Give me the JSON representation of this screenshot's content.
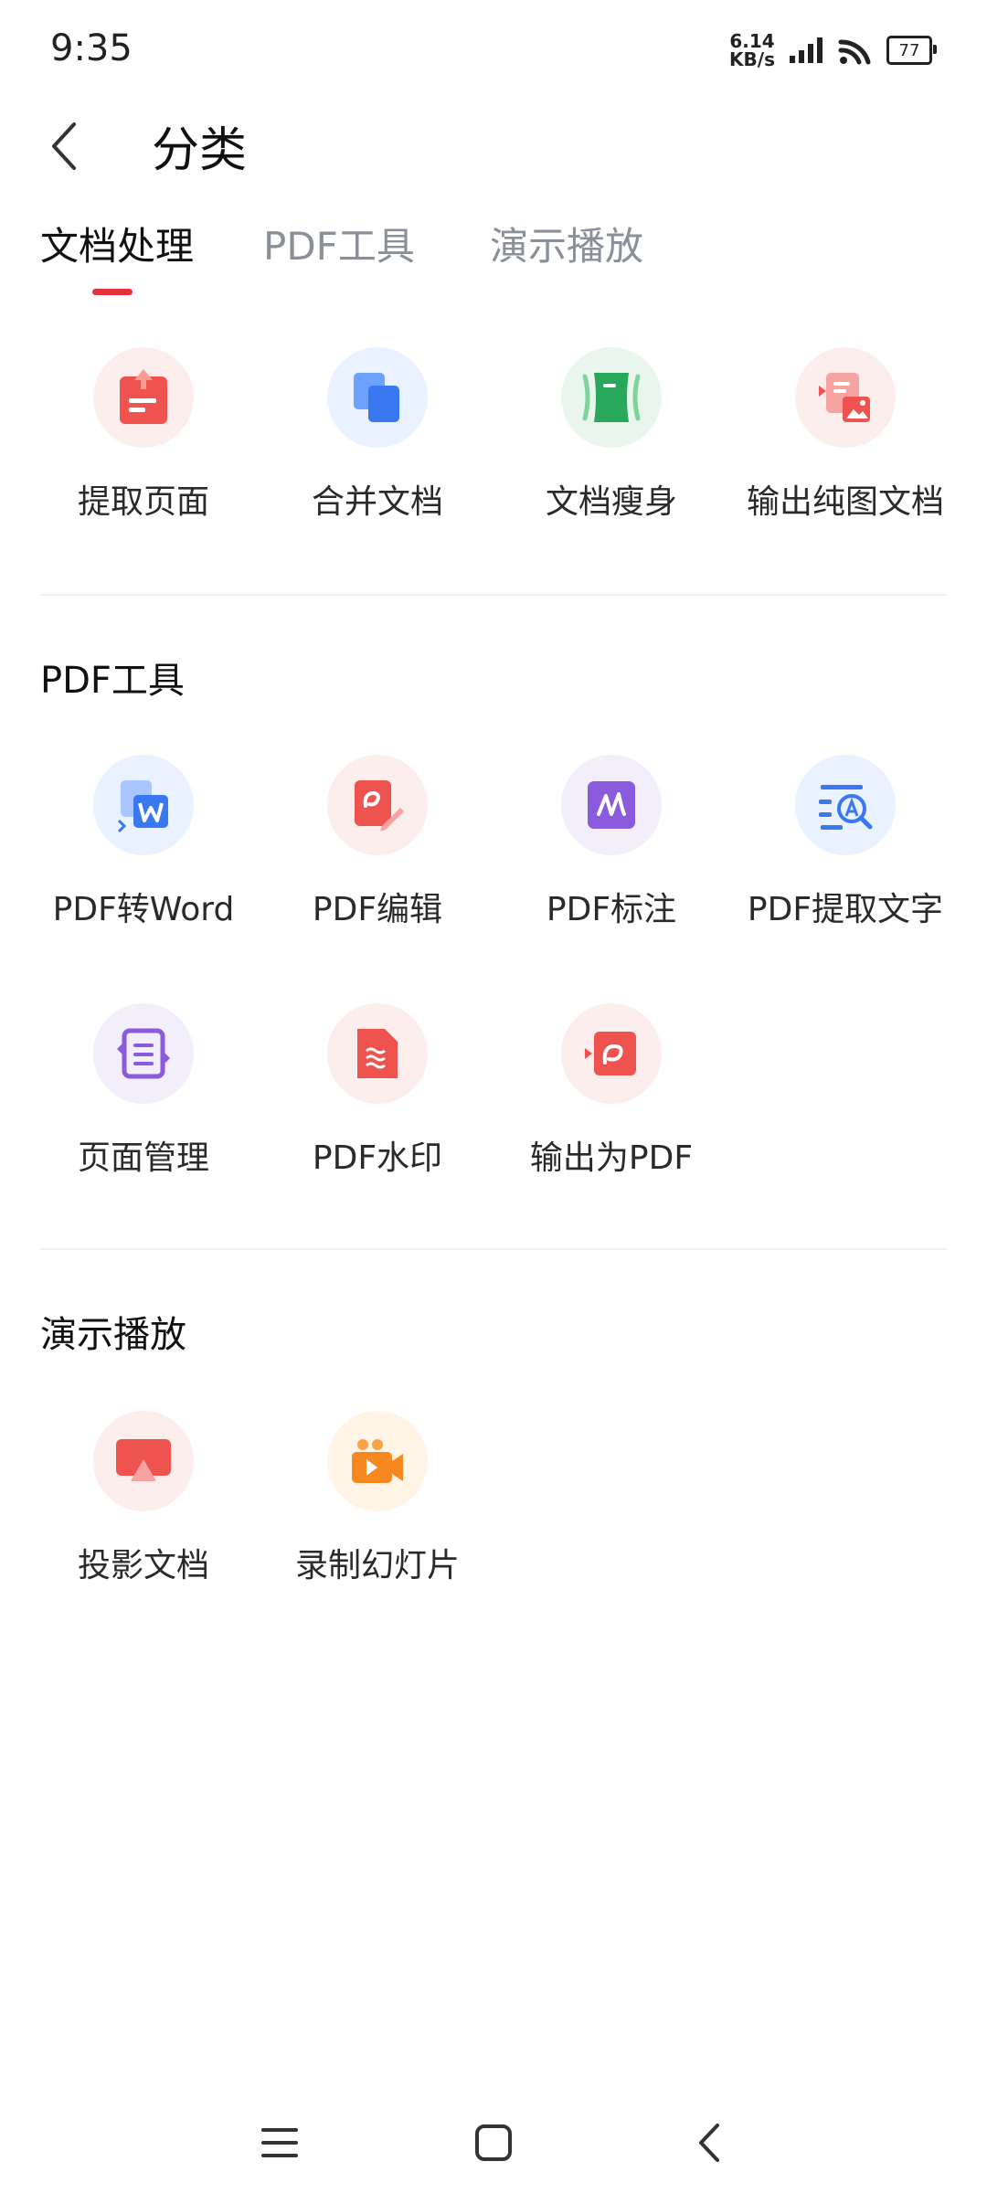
{
  "status_bar": {
    "time": "9:35",
    "net_speed_value": "6.14",
    "net_speed_unit": "KB/s",
    "battery": "77"
  },
  "header": {
    "title": "分类"
  },
  "tabs": [
    {
      "label": "文档处理",
      "active": true
    },
    {
      "label": "PDF工具",
      "active": false
    },
    {
      "label": "演示播放",
      "active": false
    }
  ],
  "sections": {
    "doc_processing": {
      "items": [
        {
          "label": "提取页面",
          "icon": "extract-page-icon"
        },
        {
          "label": "合并文档",
          "icon": "merge-docs-icon"
        },
        {
          "label": "文档瘦身",
          "icon": "slim-doc-icon"
        },
        {
          "label": "输出纯图文档",
          "icon": "image-doc-icon"
        }
      ]
    },
    "pdf_tools": {
      "title": "PDF工具",
      "items": [
        {
          "label": "PDF转Word",
          "icon": "pdf-to-word-icon"
        },
        {
          "label": "PDF编辑",
          "icon": "pdf-edit-icon"
        },
        {
          "label": "PDF标注",
          "icon": "pdf-annotate-icon"
        },
        {
          "label": "PDF提取文字",
          "icon": "pdf-ocr-icon"
        },
        {
          "label": "页面管理",
          "icon": "page-manage-icon"
        },
        {
          "label": "PDF水印",
          "icon": "pdf-watermark-icon"
        },
        {
          "label": "输出为PDF",
          "icon": "export-pdf-icon"
        }
      ]
    },
    "presentation": {
      "title": "演示播放",
      "items": [
        {
          "label": "投影文档",
          "icon": "cast-doc-icon"
        },
        {
          "label": "录制幻灯片",
          "icon": "record-slides-icon"
        }
      ]
    }
  },
  "colors": {
    "accent": "#e5323a",
    "tab_inactive": "#8a8f99"
  }
}
